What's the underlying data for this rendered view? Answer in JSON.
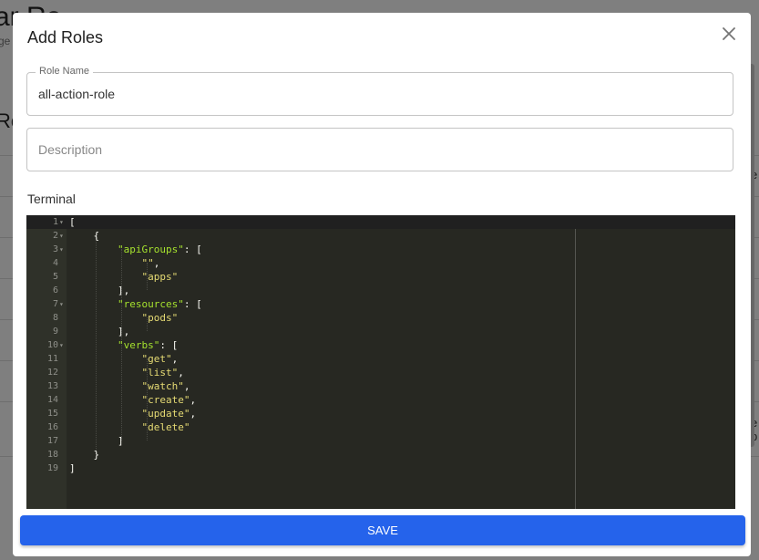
{
  "background_page": {
    "title": "ar    Ro",
    "subtitle": "ge",
    "section_heading": "Ro",
    "right_text_1": "e",
    "right_text_2a": "e",
    "right_text_2b": "p"
  },
  "modal": {
    "title": "Add Roles",
    "close_icon": "close-icon",
    "role_name": {
      "label": "Role Name",
      "value": "all-action-role"
    },
    "description": {
      "placeholder": "Description",
      "value": ""
    },
    "terminal_label": "Terminal",
    "save_label": "SAVE",
    "accent_color": "#2563eb"
  },
  "editor": {
    "theme_bg": "#272822",
    "lines": [
      {
        "n": "1",
        "fold": true
      },
      {
        "n": "2",
        "fold": true
      },
      {
        "n": "3",
        "fold": true
      },
      {
        "n": "4",
        "fold": false
      },
      {
        "n": "5",
        "fold": false
      },
      {
        "n": "6",
        "fold": false
      },
      {
        "n": "7",
        "fold": true
      },
      {
        "n": "8",
        "fold": false
      },
      {
        "n": "9",
        "fold": false
      },
      {
        "n": "10",
        "fold": true
      },
      {
        "n": "11",
        "fold": false
      },
      {
        "n": "12",
        "fold": false
      },
      {
        "n": "13",
        "fold": false
      },
      {
        "n": "14",
        "fold": false
      },
      {
        "n": "15",
        "fold": false
      },
      {
        "n": "16",
        "fold": false
      },
      {
        "n": "17",
        "fold": false
      },
      {
        "n": "18",
        "fold": false
      },
      {
        "n": "19",
        "fold": false
      }
    ],
    "tokens": {
      "l1": "[",
      "l2": "{",
      "l3_key": "\"apiGroups\"",
      "l3_rest": ": [",
      "l4_str": "\"\"",
      "l4_rest": ",",
      "l5_str": "\"apps\"",
      "l6": "],",
      "l7_key": "\"resources\"",
      "l7_rest": ": [",
      "l8_str": "\"pods\"",
      "l9": "],",
      "l10_key": "\"verbs\"",
      "l10_rest": ": [",
      "l11_str": "\"get\"",
      "l12_str": "\"list\"",
      "l13_str": "\"watch\"",
      "l14_str": "\"create\"",
      "l15_str": "\"update\"",
      "l16_str": "\"delete\"",
      "comma": ",",
      "l17": "]",
      "l18": "}",
      "l19": "]"
    }
  }
}
